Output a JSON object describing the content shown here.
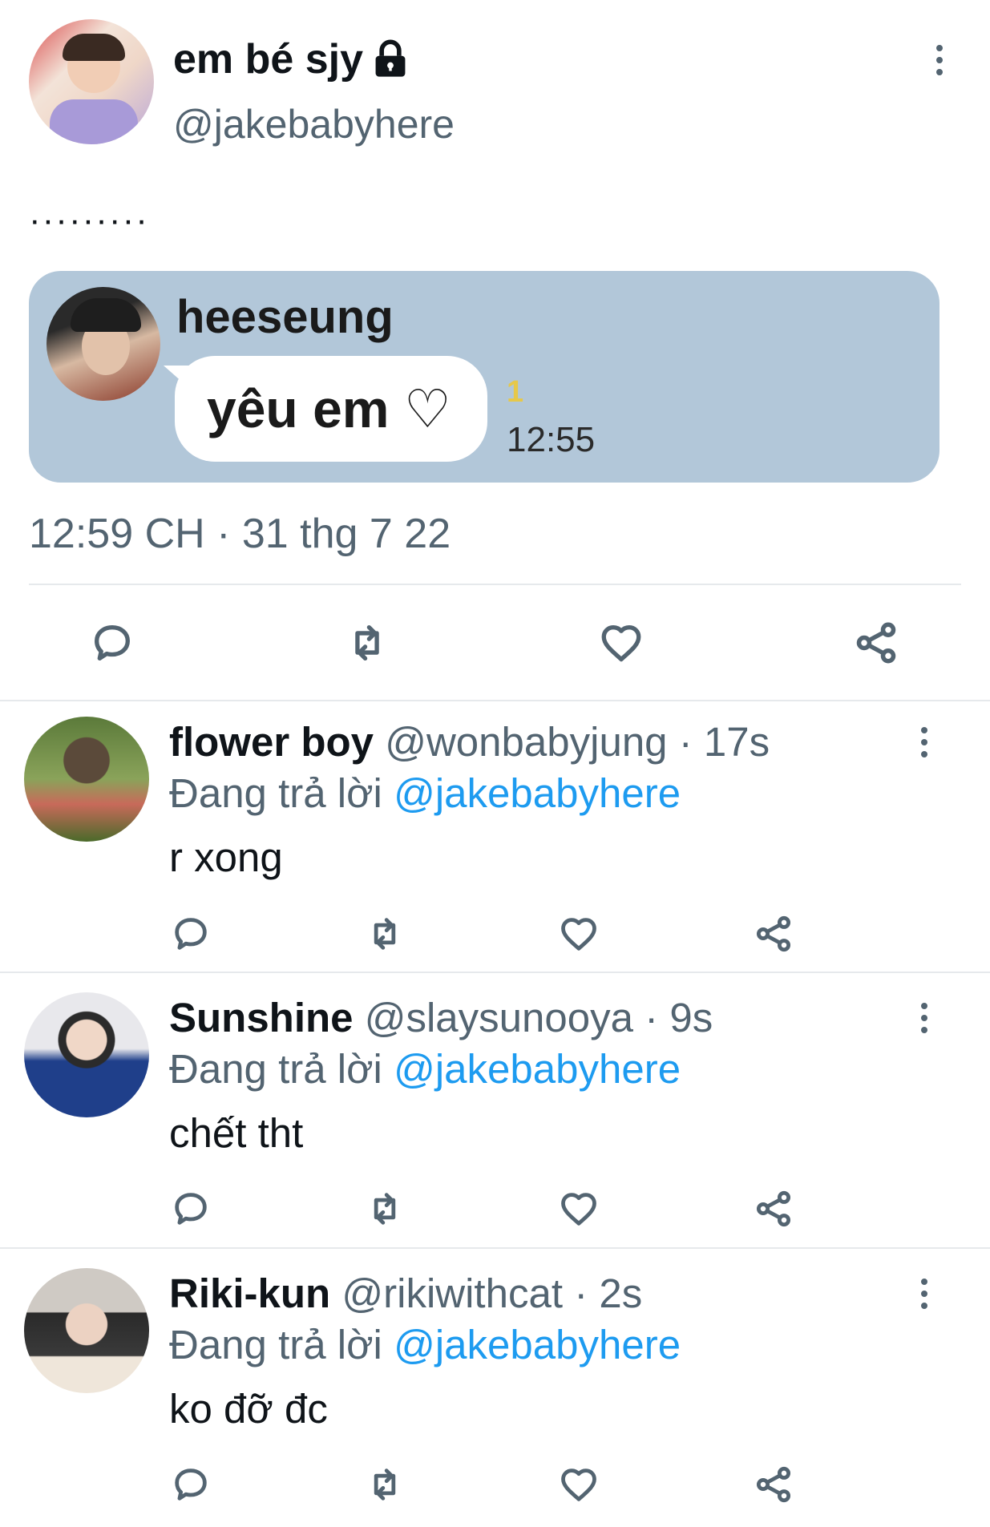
{
  "tweet": {
    "display_name": "em bé sjy",
    "handle": "@jakebabyhere",
    "text": "·········",
    "timestamp": "12:59 CH · 31 thg 7 22",
    "embed": {
      "sender_name": "heeseung",
      "message": "yêu em ♡",
      "unread_count": "1",
      "time": "12:55"
    }
  },
  "colors": {
    "accent": "#1d9bf0",
    "muted": "#536471",
    "chat_background": "#b2c7d9",
    "unread_yellow": "#e6c84a"
  },
  "icons": [
    "lock-icon",
    "more-icon",
    "reply-icon",
    "retweet-icon",
    "like-icon",
    "share-icon"
  ],
  "replying_label": "Đang trả lời",
  "replies": [
    {
      "name": "flower boy",
      "handle": "@wonbabyjung",
      "time": "· 17s",
      "reply_to": "@jakebabyhere",
      "text": "r xong"
    },
    {
      "name": "Sunshine",
      "handle": "@slaysunooya",
      "time": "· 9s",
      "reply_to": "@jakebabyhere",
      "text": "chết tht"
    },
    {
      "name": "Riki-kun",
      "handle": "@rikiwithcat",
      "time": "· 2s",
      "reply_to": "@jakebabyhere",
      "text": "ko đỡ đc"
    }
  ]
}
